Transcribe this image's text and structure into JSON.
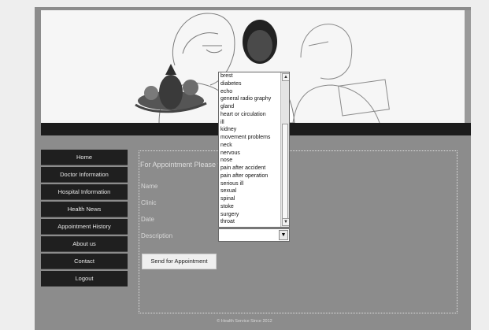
{
  "nav": {
    "items": [
      {
        "label": "Home"
      },
      {
        "label": "Doctor Information"
      },
      {
        "label": "Hospital Information"
      },
      {
        "label": "Health News"
      },
      {
        "label": "Appointment History"
      },
      {
        "label": "About us"
      },
      {
        "label": "Contact"
      },
      {
        "label": "Logout"
      }
    ]
  },
  "form": {
    "heading": "For Appointment Please f",
    "labels": {
      "name": "Name",
      "clinic": "Clinic",
      "date": "Date",
      "description": "Description"
    },
    "submit_label": "Send for Appointment"
  },
  "dropdown": {
    "options": [
      "brest",
      "diabetes",
      "echo",
      "general radio graphy",
      "gland",
      "heart or circulation",
      "ill",
      "kidney",
      "movement problems",
      "neck",
      "nervous",
      "nose",
      "pain after accident",
      "pain after operation",
      "serious ill",
      "sexual",
      "spinal",
      "stoke",
      "surgery",
      "throat"
    ],
    "selected_value": ""
  },
  "icons": {
    "scroll_up": "chevron-up-icon",
    "scroll_down": "chevron-down-icon",
    "select_arrow": "chevron-down-icon"
  },
  "footer": "© Health Service Since 2012",
  "colors": {
    "page_background": "#eeeeee",
    "content_background": "#8c8c8c",
    "nav_background": "#1f1f1f",
    "dark_bar": "#1c1c1c"
  }
}
